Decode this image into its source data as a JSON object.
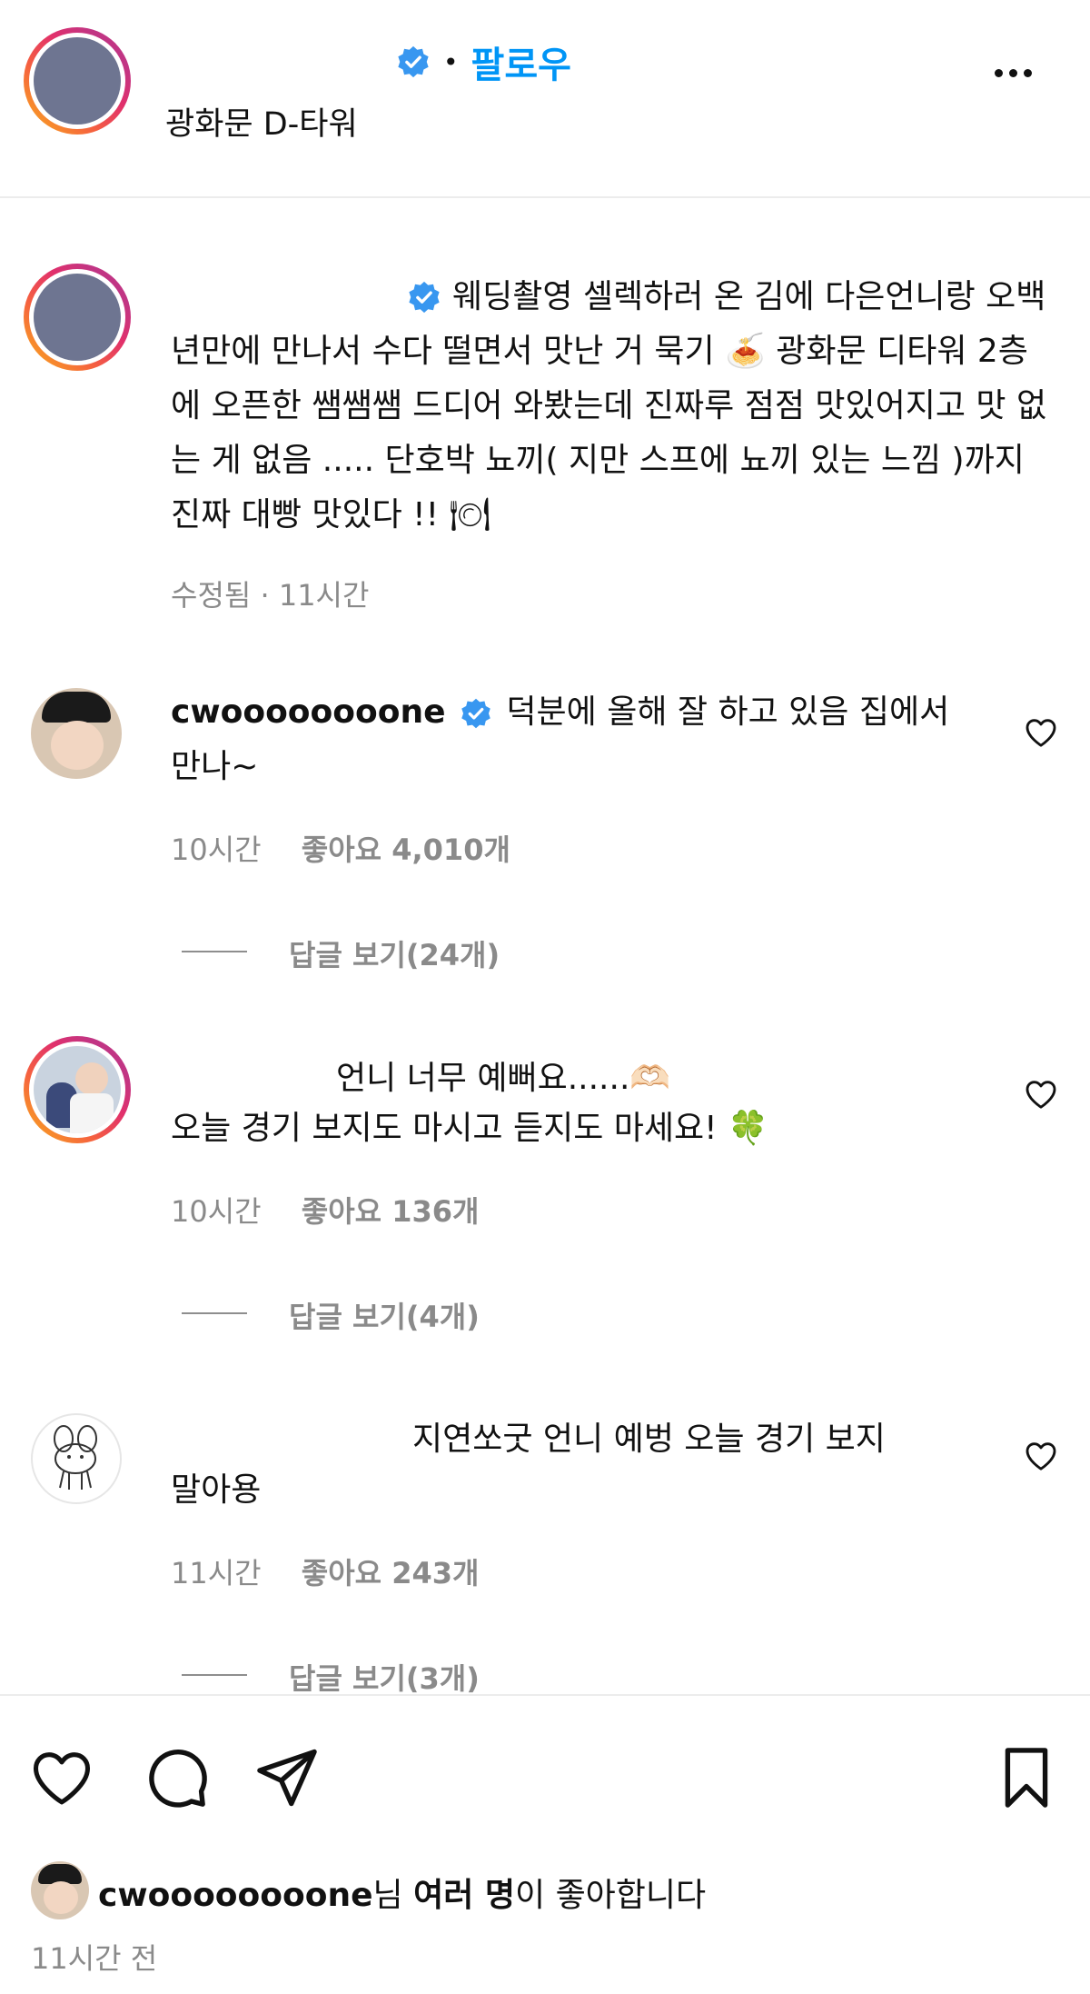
{
  "header": {
    "follow_label": "팔로우",
    "separator": "•",
    "location": "광화문 D-타워",
    "more_label": "•••"
  },
  "post": {
    "caption": "웨딩촬영 셀렉하러 온 김에 다은언니랑 오백년만에 만나서 수다 떨면서 맛난 거 묵기 🍝 광화문 디타워 2층에 오픈한 쌤쌤쌤 드디어 와봤는데 진짜루 점점 맛있어지고 맛 없는 게 없음 ..... 단호박 뇨끼( 지만 스프에 뇨끼 있는 느낌 )까지 진짜 대빵 맛있다 !! 🍽",
    "meta": "수정됨 · 11시간"
  },
  "comments": [
    {
      "username": "cwoooooooone",
      "text": "덕분에 올해 잘 하고 있음 집에서 만나~",
      "time": "10시간",
      "likes": "좋아요 4,010개",
      "replies": "답글 보기(24개)"
    },
    {
      "username": "",
      "text_line1": "언니 너무 예뻐요......🫶🏻",
      "text_line2": "오늘 경기 보지도 마시고 듣지도 마세요! 🍀",
      "time": "10시간",
      "likes": "좋아요 136개",
      "replies": "답글 보기(4개)"
    },
    {
      "username": "",
      "text_line1": "지연쏘굿 언니 예벙 오늘 경기 보지",
      "text_line2": "말아용",
      "time": "11시간",
      "likes": "좋아요 243개",
      "replies": "답글 보기(3개)"
    }
  ],
  "footer": {
    "liked_by_user": "cwoooooooone",
    "liked_by_suffix_1": "님 ",
    "liked_by_bold": "여러 명",
    "liked_by_suffix_2": "이 좋아합니다",
    "timestamp": "11시간 전"
  },
  "icons": {
    "verified_color": "#3897f0",
    "follow_color": "#0095f6"
  }
}
